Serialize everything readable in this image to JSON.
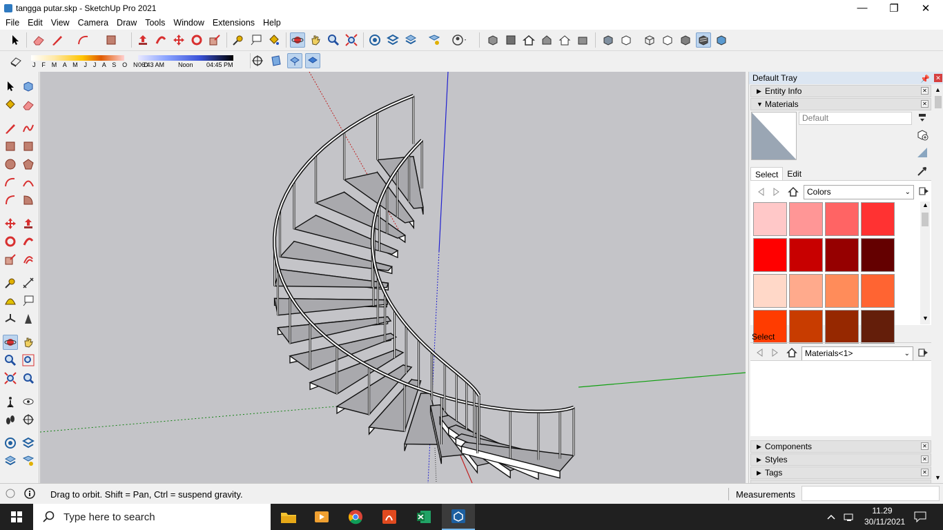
{
  "window": {
    "title": "tangga putar.skp - SketchUp Pro 2021",
    "minimize": "—",
    "maximize": "❐",
    "close": "✕"
  },
  "menu": [
    "File",
    "Edit",
    "View",
    "Camera",
    "Draw",
    "Tools",
    "Window",
    "Extensions",
    "Help"
  ],
  "shadow": {
    "months": "J F M A M J J A S O N D",
    "time_start": "06:43 AM",
    "time_noon": "Noon",
    "time_end": "04:45 PM"
  },
  "tray": {
    "title": "Default Tray",
    "entity_info": "Entity Info",
    "materials": "Materials",
    "material_name": "Default",
    "tab_select": "Select",
    "tab_edit": "Edit",
    "collection": "Colors",
    "select2_label": "Select",
    "collection2": "Materials<1>",
    "components": "Components",
    "styles": "Styles",
    "tags": "Tags",
    "swatches": [
      "#ffc8c8",
      "#ff9696",
      "#ff6464",
      "#ff3232",
      "#ff0000",
      "#c80000",
      "#960000",
      "#640000",
      "#ffd8c8",
      "#ffaa8c",
      "#ff8c5a",
      "#ff6432",
      "#ff3c00",
      "#c83c00",
      "#962800",
      "#641e0a"
    ]
  },
  "status": {
    "text": "Drag to orbit. Shift = Pan, Ctrl = suspend gravity.",
    "measurements_label": "Measurements"
  },
  "taskbar": {
    "search_placeholder": "Type here to search",
    "time": "11.29",
    "date": "30/11/2021"
  },
  "colors": {
    "sky": "#c4c4c8",
    "tray_header": "#dce6f2",
    "selected_tool": "#bcd4ee",
    "taskbar": "#202020"
  }
}
